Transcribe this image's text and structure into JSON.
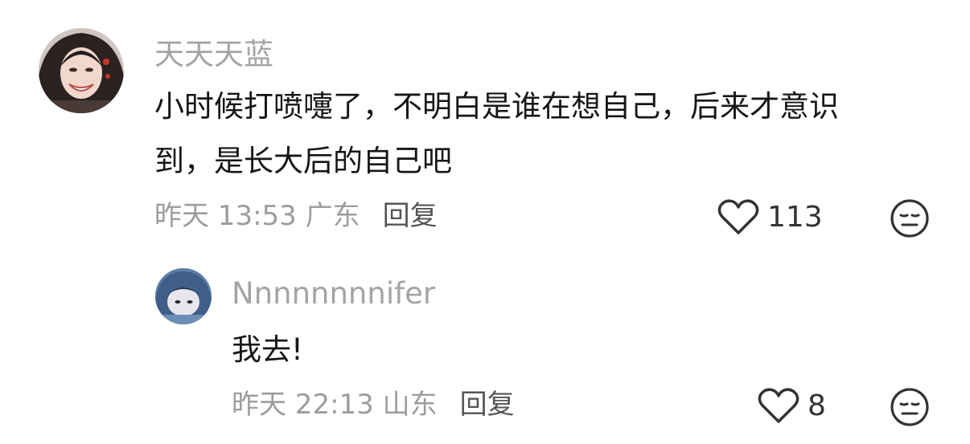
{
  "comment": {
    "username": "天天天蓝",
    "text_line1": "小时候打喷嚏了，不明白是谁在想自己，后来才意识",
    "text_line2": "到，是长大后的自己吧",
    "meta": "昨天 13:53 广东",
    "reply_label": "回复",
    "like_count": "113",
    "avatar_icon": "profile-photo",
    "like_icon": "heart-outline-icon",
    "dislike_icon": "neutral-face-icon"
  },
  "reply": {
    "username": "Nnnnnnnnifer",
    "text": "我去!",
    "meta": "昨天 22:13 山东",
    "reply_label": "回复",
    "like_count": "8",
    "avatar_icon": "profile-photo",
    "like_icon": "heart-outline-icon",
    "dislike_icon": "neutral-face-icon"
  },
  "colors": {
    "username": "#a4a4a4",
    "text": "#161616",
    "meta": "#9d9d9d",
    "reply": "#555555",
    "icon": "#333333"
  }
}
